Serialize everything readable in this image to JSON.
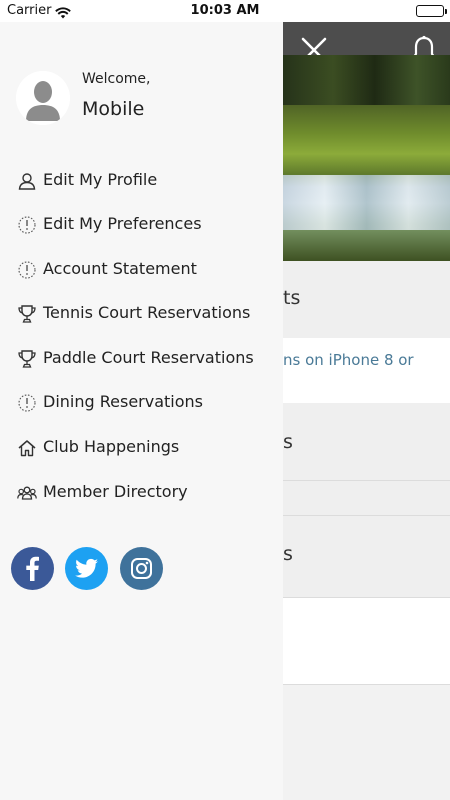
{
  "status_bar": {
    "carrier": "Carrier",
    "time": "10:03 AM"
  },
  "drawer": {
    "welcome": "Welcome,",
    "user_name": "Mobile",
    "menu": [
      {
        "label": "Edit My Profile",
        "icon": "person-icon"
      },
      {
        "label": "Edit My Preferences",
        "icon": "info-icon"
      },
      {
        "label": "Account Statement",
        "icon": "info-icon"
      },
      {
        "label": "Tennis Court Reservations",
        "icon": "trophy-icon"
      },
      {
        "label": "Paddle Court Reservations",
        "icon": "trophy-icon"
      },
      {
        "label": "Dining Reservations",
        "icon": "info-icon"
      },
      {
        "label": "Club Happenings",
        "icon": "home-icon"
      },
      {
        "label": "Member Directory",
        "icon": "group-icon"
      }
    ],
    "social": [
      {
        "name": "facebook-icon",
        "color": "#3b5998"
      },
      {
        "name": "twitter-icon",
        "color": "#1da1f2"
      },
      {
        "name": "instagram-icon",
        "color": "#3f729b"
      }
    ]
  },
  "background_page": {
    "header_color": "#4d4d4d",
    "rows": [
      {
        "text": "ts"
      },
      {
        "text": "ns on iPhone 8 or"
      },
      {
        "text": "s"
      },
      {
        "text": "s"
      }
    ]
  }
}
